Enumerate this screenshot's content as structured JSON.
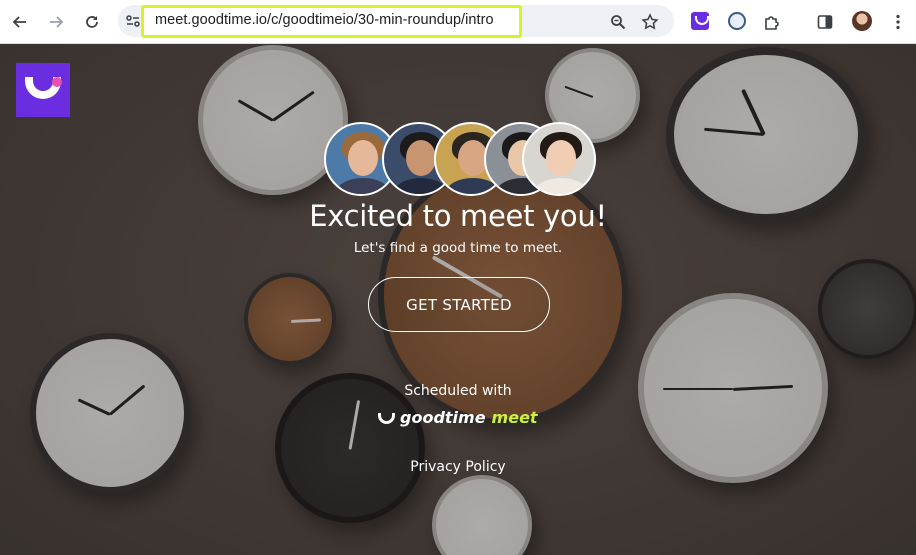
{
  "browser": {
    "url": "meet.goodtime.io/c/goodtimeio/30-min-roundup/intro",
    "icons": [
      "back-arrow-icon",
      "forward-arrow-icon",
      "reload-icon",
      "site-info-icon",
      "zoom-icon",
      "bookmark-star-icon",
      "goodtime-extension-icon",
      "password-extension-icon",
      "extensions-puzzle-icon",
      "side-panel-icon",
      "profile-avatar",
      "menu-kebab-icon"
    ]
  },
  "page": {
    "headline": "Excited to meet you!",
    "subline": "Let's find a good time to meet.",
    "cta_label": "GET STARTED",
    "scheduled_with": "Scheduled with",
    "brand_primary": "goodtime",
    "brand_secondary": "meet",
    "privacy_link": "Privacy Policy"
  },
  "colors": {
    "brand_purple": "#6b2de0",
    "brand_pink": "#e84fae",
    "meet_green": "#c9f23d",
    "url_highlight": "#d8f223"
  }
}
